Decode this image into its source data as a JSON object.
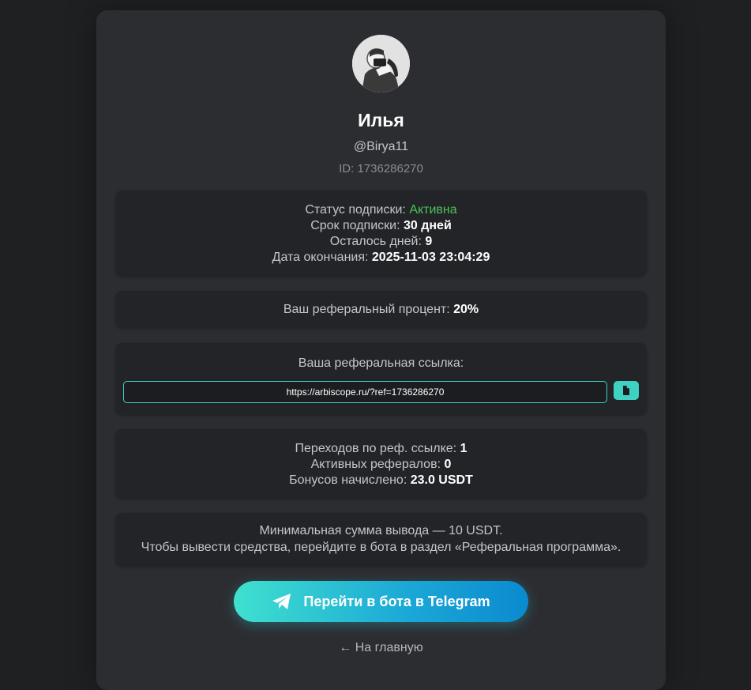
{
  "profile": {
    "name": "Илья",
    "username": "@Birya11",
    "id_text": "ID: 1736286270"
  },
  "subscription": {
    "status_label": "Статус подписки: ",
    "status_value": "Активна",
    "term_label": "Срок подписки: ",
    "term_value": "30 дней",
    "days_left_label": "Осталось дней: ",
    "days_left_value": "9",
    "end_date_label": "Дата окончания: ",
    "end_date_value": "2025-11-03 23:04:29"
  },
  "referral_percent": {
    "label": "Ваш реферальный процент: ",
    "value": "20%"
  },
  "referral_link": {
    "label": "Ваша реферальная ссылка:",
    "url": "https://arbiscope.ru/?ref=1736286270",
    "copy_icon": "copy-icon"
  },
  "stats": {
    "clicks_label": "Переходов по реф. ссылке: ",
    "clicks_value": "1",
    "active_label": "Активных рефералов: ",
    "active_value": "0",
    "bonus_label": "Бонусов начислено: ",
    "bonus_value": "23.0 USDT"
  },
  "withdraw_info": {
    "line1": "Минимальная сумма вывода — 10 USDT.",
    "line2": "Чтобы вывести средства, перейдите в бота в раздел «Реферальная программа»."
  },
  "telegram_button": {
    "label": "Перейти в бота в Telegram",
    "icon": "telegram-plane-icon"
  },
  "home_link": {
    "label": "← На главную"
  },
  "colors": {
    "accent": "#3fd1c4",
    "status_active": "#4cc45a",
    "card_bg": "#2c2d31",
    "page_bg": "#1f2022"
  }
}
